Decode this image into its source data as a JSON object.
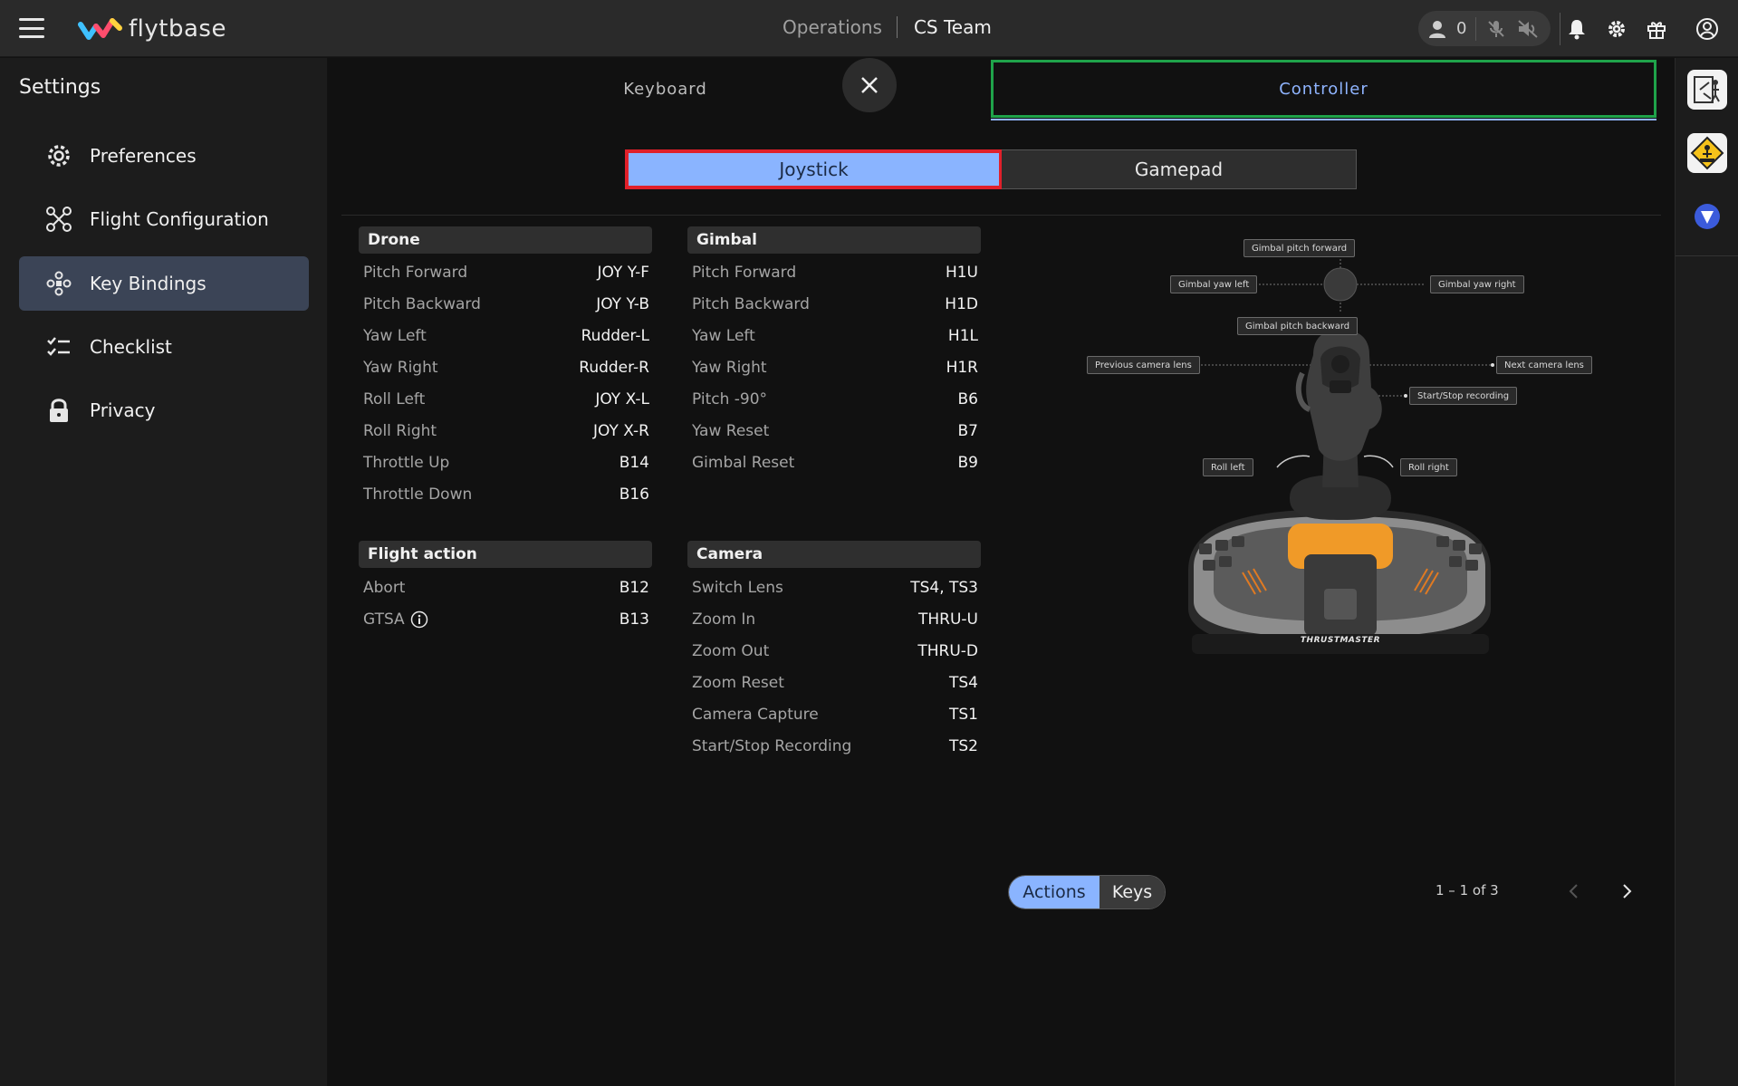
{
  "header": {
    "logo_text": "flytbase",
    "nav_operations": "Operations",
    "nav_team": "CS Team",
    "user_count": "0"
  },
  "sidebar": {
    "title": "Settings",
    "items": [
      {
        "label": "Preferences",
        "icon": "gear-icon"
      },
      {
        "label": "Flight Configuration",
        "icon": "drone-icon"
      },
      {
        "label": "Key Bindings",
        "icon": "gamepad-icon",
        "active": true
      },
      {
        "label": "Checklist",
        "icon": "checklist-icon"
      },
      {
        "label": "Privacy",
        "icon": "lock-icon"
      }
    ]
  },
  "tabs": {
    "keyboard": "Keyboard",
    "controller": "Controller"
  },
  "device": {
    "joystick": "Joystick",
    "gamepad": "Gamepad"
  },
  "groups": {
    "drone": {
      "title": "Drone",
      "rows": [
        {
          "action": "Pitch Forward",
          "key": "JOY Y-F"
        },
        {
          "action": "Pitch Backward",
          "key": "JOY Y-B"
        },
        {
          "action": "Yaw Left",
          "key": "Rudder-L"
        },
        {
          "action": "Yaw Right",
          "key": "Rudder-R"
        },
        {
          "action": "Roll Left",
          "key": "JOY X-L"
        },
        {
          "action": "Roll Right",
          "key": "JOY X-R"
        },
        {
          "action": "Throttle Up",
          "key": "B14"
        },
        {
          "action": "Throttle Down",
          "key": "B16"
        }
      ]
    },
    "gimbal": {
      "title": "Gimbal",
      "rows": [
        {
          "action": "Pitch Forward",
          "key": "H1U"
        },
        {
          "action": "Pitch Backward",
          "key": "H1D"
        },
        {
          "action": "Yaw Left",
          "key": "H1L"
        },
        {
          "action": "Yaw Right",
          "key": "H1R"
        },
        {
          "action": "Pitch -90°",
          "key": "B6"
        },
        {
          "action": "Yaw Reset",
          "key": "B7"
        },
        {
          "action": "Gimbal Reset",
          "key": "B9"
        }
      ]
    },
    "flight_action": {
      "title": "Flight action",
      "rows": [
        {
          "action": "Abort",
          "key": "B12"
        },
        {
          "action": "GTSA",
          "key": "B13"
        }
      ]
    },
    "camera": {
      "title": "Camera",
      "rows": [
        {
          "action": "Switch Lens",
          "key": "TS4, TS3"
        },
        {
          "action": "Zoom In",
          "key": "THRU-U"
        },
        {
          "action": "Zoom Out",
          "key": "THRU-D"
        },
        {
          "action": "Zoom Reset",
          "key": "TS4"
        },
        {
          "action": "Camera Capture",
          "key": "TS1"
        },
        {
          "action": "Start/Stop Recording",
          "key": "TS2"
        }
      ]
    }
  },
  "diagram": {
    "labels": {
      "gimbal_pitch_forward": "Gimbal pitch forward",
      "gimbal_yaw_left": "Gimbal yaw left",
      "gimbal_yaw_right": "Gimbal yaw right",
      "gimbal_pitch_backward": "Gimbal pitch backward",
      "previous_camera_lens": "Previous camera lens",
      "next_camera_lens": "Next camera lens",
      "start_stop_recording": "Start/Stop recording",
      "roll_left": "Roll left",
      "roll_right": "Roll right"
    },
    "brand": "THRUSTMASTER"
  },
  "view_toggle": {
    "actions": "Actions",
    "keys": "Keys"
  },
  "pager": {
    "range": "1 – 1 of 3"
  },
  "colors": {
    "accent": "#8ab4ff",
    "highlight_green": "#1fa34a",
    "highlight_red": "#e0202a",
    "active_menu": "#3b4456"
  }
}
